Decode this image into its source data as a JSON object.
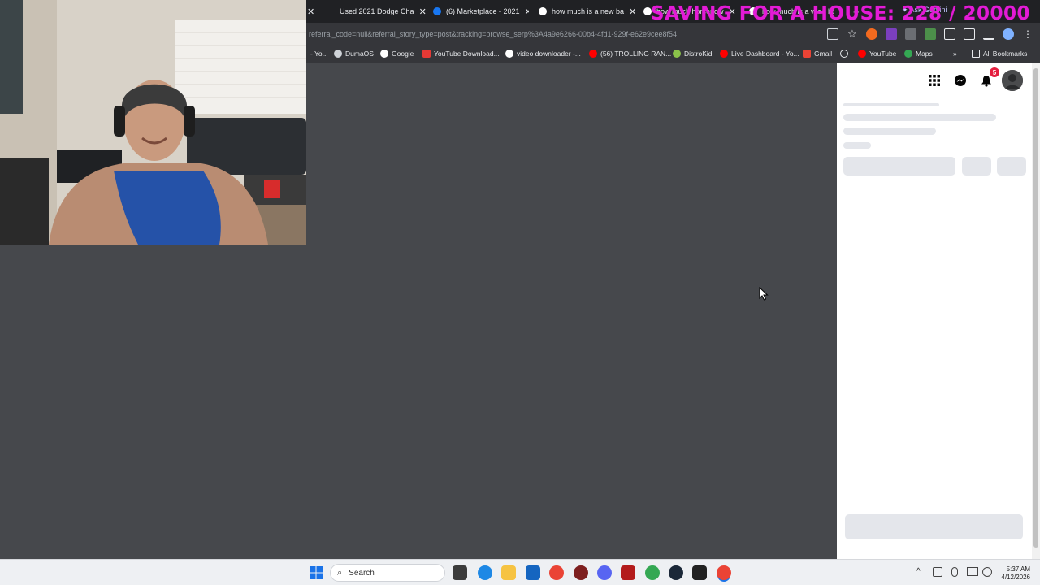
{
  "overlay": {
    "saving_text": "SAVING FOR A HOUSE: 228 / 20000"
  },
  "tabs": [
    {
      "title": "Used 2021 Dodge Cha",
      "favicon": "car-icon",
      "color": "#9aa0a6"
    },
    {
      "title": "(6) Marketplace - 2021",
      "favicon": "facebook-icon",
      "color": "#1877f2"
    },
    {
      "title": "how much is a new ba",
      "favicon": "google-icon",
      "color": "#ffffff"
    },
    {
      "title": "how much horsepow",
      "favicon": "google-icon",
      "color": "#ffffff"
    },
    {
      "title": "how much is a wide bo",
      "favicon": "google-icon",
      "color": "#ffffff"
    }
  ],
  "toolbar": {
    "gemini_label": "Ask Gemini",
    "url": "referral_code=null&referral_story_type=post&tracking=browse_serp%3A4a9e6266-00b4-4fd1-929f-e62e9cee8f54"
  },
  "bookmarks": [
    {
      "label": "- Yo...",
      "icon": "youtube-icon",
      "color": "#9aa0a6"
    },
    {
      "label": "DumaOS",
      "icon": "dumaos-icon",
      "color": "#cfd3d8"
    },
    {
      "label": "Google",
      "icon": "google-icon",
      "color": "#ffffff"
    },
    {
      "label": "YouTube Download...",
      "icon": "download-icon",
      "color": "#e53935"
    },
    {
      "label": "video downloader -...",
      "icon": "google-icon",
      "color": "#ffffff"
    },
    {
      "label": "(56) TROLLING RAN...",
      "icon": "youtube-icon",
      "color": "#ff0000"
    },
    {
      "label": "DistroKid",
      "icon": "distrokid-icon",
      "color": "#8bc34a"
    },
    {
      "label": "Live Dashboard - Yo...",
      "icon": "youtube-icon",
      "color": "#ff0000"
    },
    {
      "label": "Gmail",
      "icon": "gmail-icon",
      "color": "#ea4335"
    },
    {
      "label": "",
      "icon": "globe-icon",
      "color": "#e8eaed"
    },
    {
      "label": "YouTube",
      "icon": "youtube-icon",
      "color": "#ff0000"
    },
    {
      "label": "Maps",
      "icon": "maps-icon",
      "color": "#34a853"
    }
  ],
  "bookmarks_overflow": "»",
  "all_bookmarks": "All Bookmarks",
  "facebook": {
    "notification_count": "5"
  },
  "taskbar": {
    "search_placeholder": "Search",
    "time": "5:37 AM",
    "date": "4/12/2026"
  }
}
